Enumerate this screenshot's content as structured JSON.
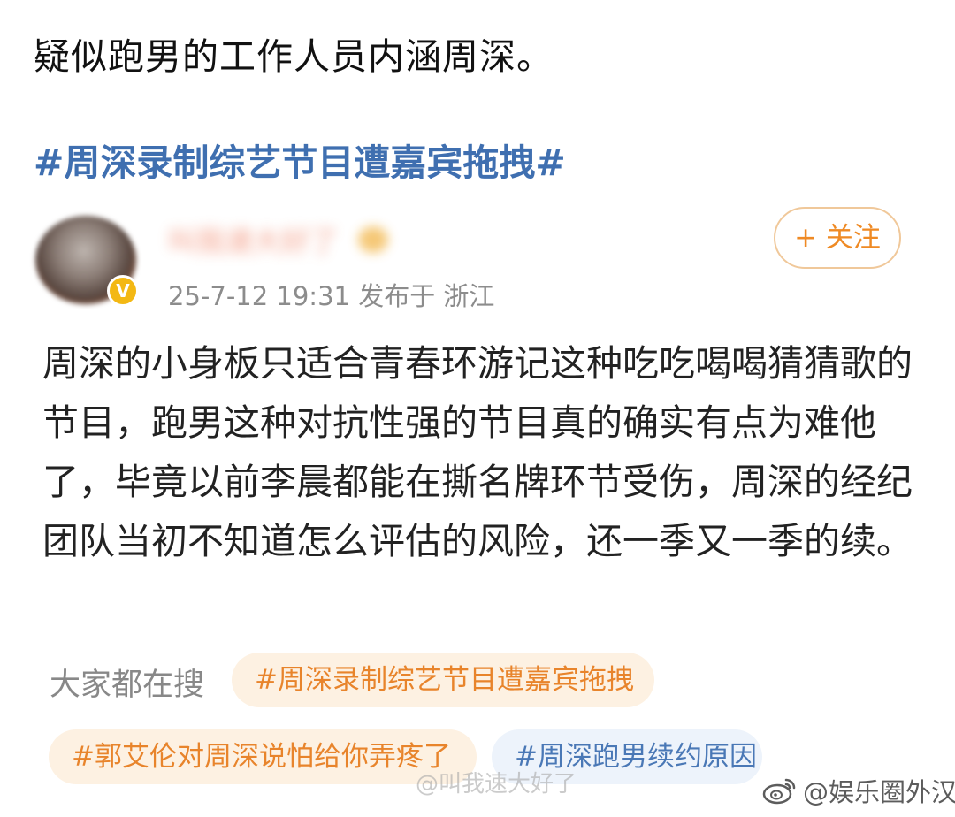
{
  "caption": "疑似跑男的工作人员内涵周深。",
  "hashtag_title": "#周深录制综艺节目遭嘉宾拖拽#",
  "post": {
    "username": "叫我速大好了",
    "verified_mark": "V",
    "meta": "25-7-12 19:31  发布于 浙江",
    "follow_label": "+ 关注",
    "body": "周深的小身板只适合青春环游记这种吃吃喝喝猜猜歌的节目，跑男这种对抗性强的节目真的确实有点为难他了，毕竟以前李晨都能在撕名牌环节受伤，周深的经纪团队当初不知道怎么评估的风险，还一季又一季的续。"
  },
  "search": {
    "label": "大家都在搜",
    "chips": [
      "#周深录制综艺节目遭嘉宾拖拽",
      "#郭艾伦对周深说怕给你弄疼了",
      "#周深跑男续约原因"
    ]
  },
  "watermark": {
    "faint_text": "@叫我速大好了",
    "text": "@娱乐圈外汉"
  },
  "colors": {
    "hashtag_blue": "#3f6fb0",
    "follow_orange": "#ef8a24",
    "chip_orange_text": "#e8842b",
    "chip_blue_text": "#4a78b6"
  },
  "icons": {
    "weibo": "weibo-logo-icon",
    "verified": "verified-badge-icon"
  }
}
